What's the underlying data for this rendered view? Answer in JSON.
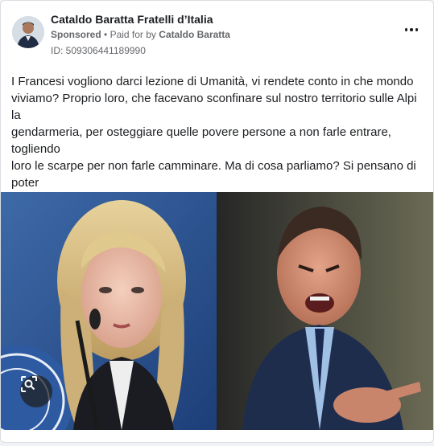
{
  "advertiser": {
    "name": "Cataldo Baratta Fratelli d’Italia",
    "sponsored_label": "Sponsored",
    "separator": "•",
    "paid_for_by_label": "Paid for by",
    "payer": "Cataldo Baratta",
    "ad_id": "ID: 509306441189990"
  },
  "post": {
    "text": "I Francesi vogliono darci lezione di Umanità, vi rendete conto in che mondo\nviviamo? Proprio loro, che facevano sconfinare sul nostro territorio sulle Alpi la\ngendarmeria, per osteggiare quelle povere persone a non farle entrare, togliendo\nloro le scarpe per non farle camminare. Ma di cosa parliamo? Si pensano di poter\nfare la voce grossa come una volta perché non avevamo un governo presente e\nstabile? Caro Macron, noi continueremo ad aiutare il prossimo come abbiamo\nsempre fatto perché siamo umani, ma non saremo più la pattumiera dell’Europa.…"
  },
  "media": {
    "icons": {
      "menu": "more-dots-icon",
      "visual_search": "lens-icon"
    }
  },
  "colors": {
    "primary_text": "#1c1e21",
    "secondary_text": "#65676b",
    "card_background": "#ffffff",
    "card_border": "#dadde1"
  }
}
